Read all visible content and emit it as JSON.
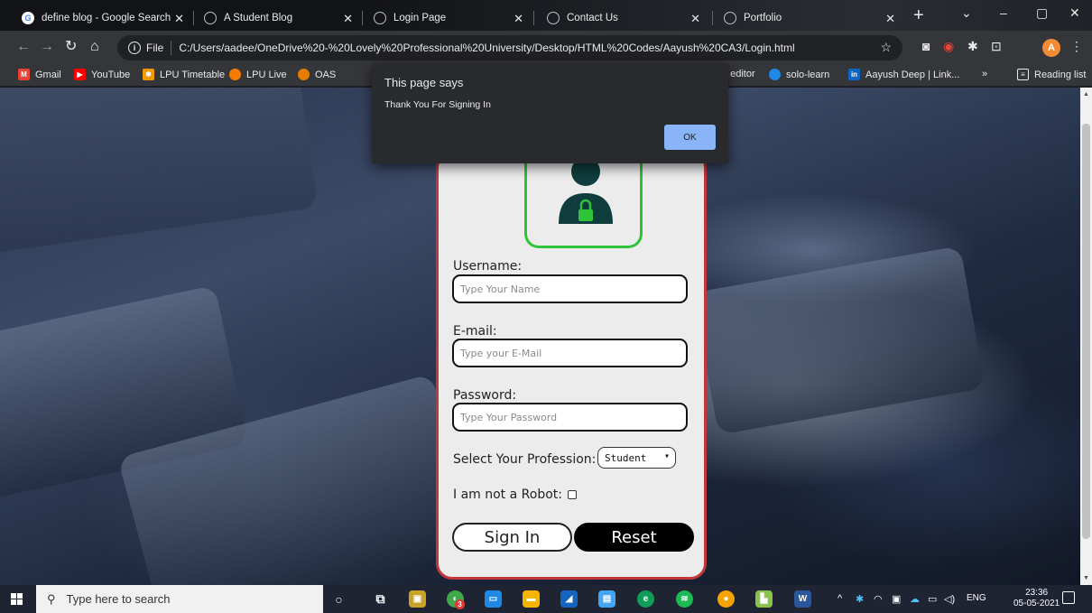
{
  "browser": {
    "tabs": [
      {
        "title": "define blog - Google Search",
        "icon": "google-icon"
      },
      {
        "title": "A Student Blog",
        "icon": "globe-icon"
      },
      {
        "title": "Login Page",
        "icon": "globe-icon"
      },
      {
        "title": "Contact Us",
        "icon": "globe-icon"
      },
      {
        "title": "Portfolio",
        "icon": "globe-icon"
      }
    ],
    "address": {
      "scheme_label": "File",
      "url": "C:/Users/aadee/OneDrive%20-%20Lovely%20Professional%20University/Desktop/HTML%20Codes/Aayush%20CA3/Login.html"
    },
    "profile_initial": "A",
    "bookmarks": [
      {
        "label": "Gmail",
        "color": "#ea4335"
      },
      {
        "label": "YouTube",
        "color": "#ff0000"
      },
      {
        "label": "LPU Timetable",
        "color": "#f29900"
      },
      {
        "label": "LPU Live",
        "color": "#f57c00"
      },
      {
        "label": "OAS",
        "color": "#e57c00"
      },
      {
        "label": "f editor",
        "color": "#5f6368"
      },
      {
        "label": "solo-learn",
        "color": "#1e88e5"
      },
      {
        "label": "Aayush Deep | Link...",
        "color": "#0a66c2"
      }
    ],
    "reading_list": "Reading list",
    "more_bookmarks": "»"
  },
  "dialog": {
    "title": "This page says",
    "message": "Thank You For Signing In",
    "ok_label": "OK"
  },
  "form": {
    "username_label": "Username:",
    "username_placeholder": "Type Your Name",
    "email_label": "E-mail:",
    "email_placeholder": "Type your E-Mail",
    "password_label": "Password:",
    "password_placeholder": "Type Your Password",
    "profession_label": "Select Your Profession:",
    "profession_value": "Student",
    "robot_label": "I am not a Robot:",
    "robot_checked": false,
    "signin_label": "Sign In",
    "reset_label": "Reset"
  },
  "colors": {
    "card_border": "#c1373c",
    "avatar_border": "#2ec43a",
    "avatar_fill": "#0f3d3e",
    "dialog_ok": "#8ab4f8"
  },
  "taskbar": {
    "search_placeholder": "Type here to search",
    "language": "ENG",
    "time": "23:36",
    "date": "05-05-2021",
    "badge_count": "3"
  }
}
